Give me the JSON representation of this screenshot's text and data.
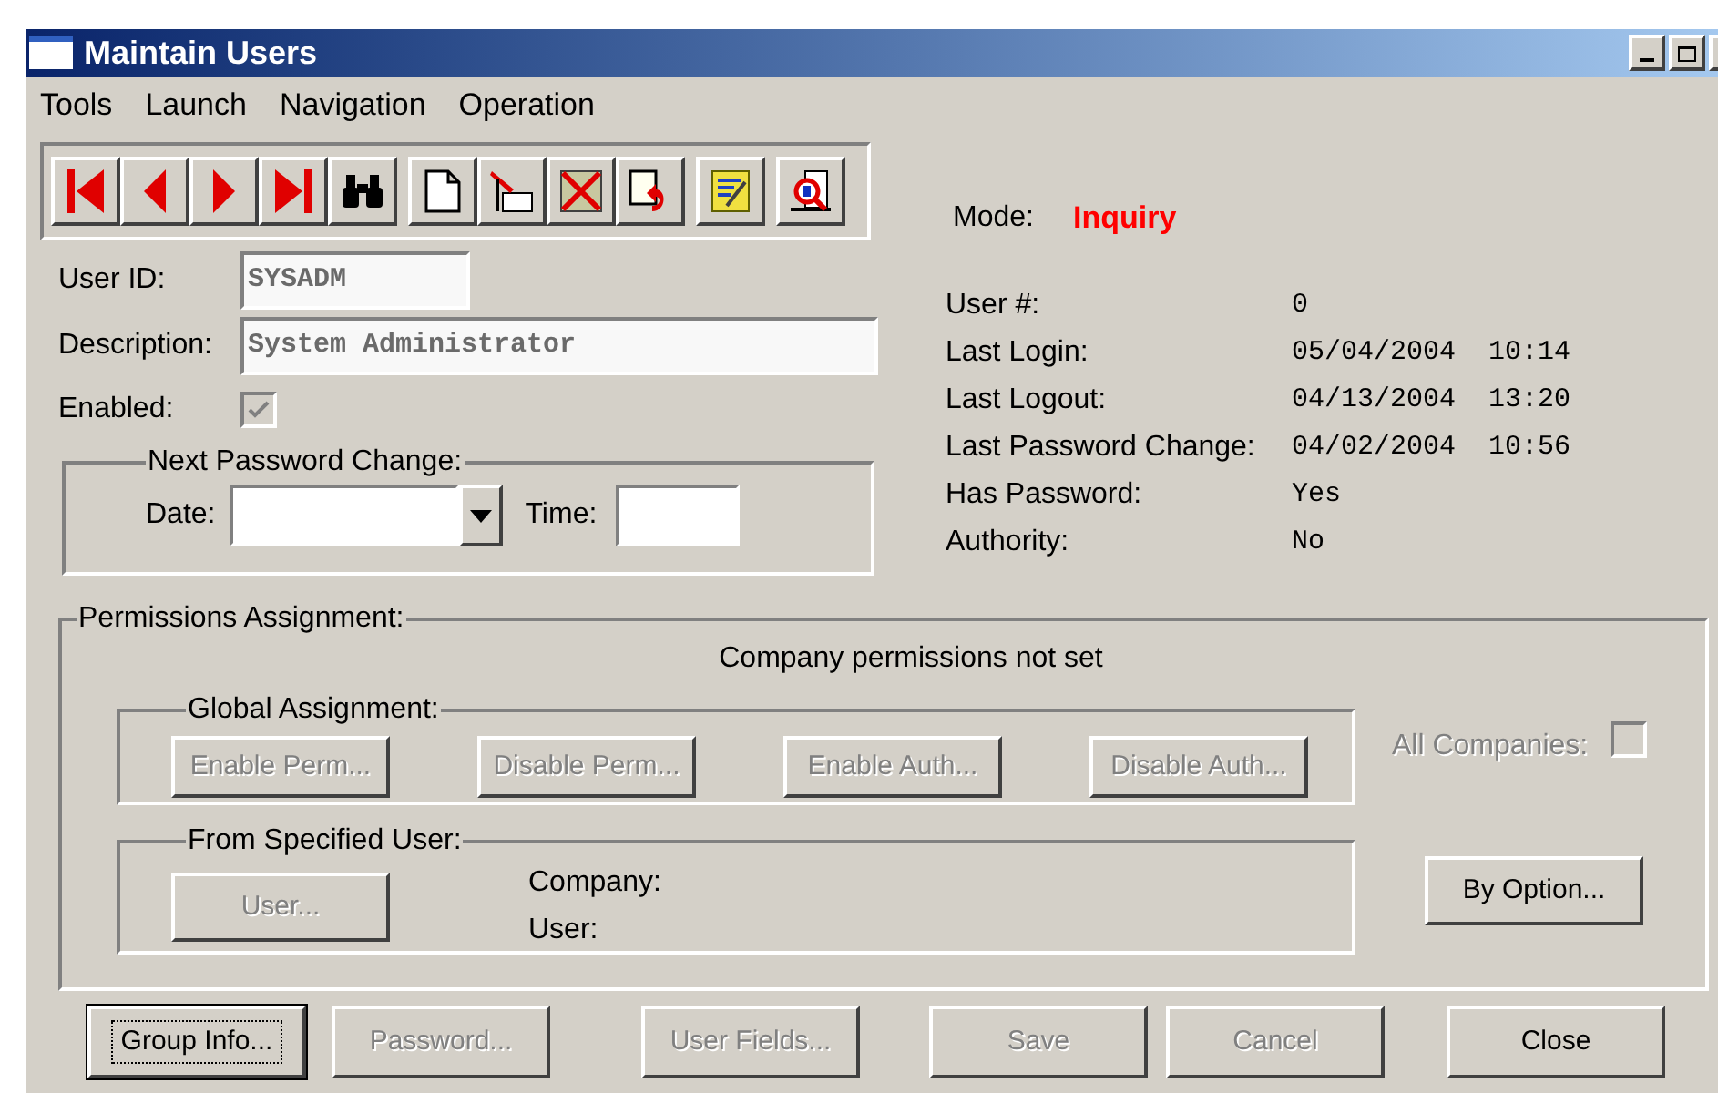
{
  "window": {
    "title": "Maintain Users"
  },
  "menu": [
    {
      "label": "Tools"
    },
    {
      "label": "Launch"
    },
    {
      "label": "Navigation"
    },
    {
      "label": "Operation"
    }
  ],
  "user_id": {
    "label": "User ID:",
    "value": "SYSADM",
    "disabled": true
  },
  "description": {
    "label": "Description:",
    "value": "System Administrator",
    "disabled": true
  },
  "enabled": {
    "label": "Enabled:",
    "checked": true,
    "disabled": true
  },
  "next_password_change": {
    "title": "Next Password Change:",
    "date_label": "Date:",
    "time_label": "Time:"
  },
  "mode": {
    "label": "Mode:",
    "value": "Inquiry"
  },
  "info": [
    {
      "label": "User #:",
      "value": "0"
    },
    {
      "label": "Last Login:",
      "value": "05/04/2004  10:14"
    },
    {
      "label": "Last Logout:",
      "value": "04/13/2004  13:20"
    },
    {
      "label": "Last Password Change:",
      "value": "04/02/2004  10:56"
    },
    {
      "label": "Has Password:",
      "value": "Yes"
    },
    {
      "label": "Authority:",
      "value": "No"
    }
  ],
  "permissions": {
    "title": "Permissions Assignment:",
    "message": "Company permissions not set",
    "global_assignment": {
      "title": "Global Assignment:",
      "buttons": [
        {
          "label": "Enable Perm...",
          "disabled": true
        },
        {
          "label": "Disable Perm...",
          "disabled": true
        },
        {
          "label": "Enable Auth...",
          "disabled": true
        },
        {
          "label": "Disable Auth...",
          "disabled": true
        }
      ]
    },
    "all_companies": {
      "label": "All Companies:",
      "checked": false,
      "disabled": true
    },
    "from_specified_user": {
      "title": "From Specified User:",
      "user_button": {
        "label": "User...",
        "disabled": true
      },
      "company_label": "Company:",
      "user_label": "User:"
    },
    "by_option": {
      "label": "By Option...",
      "disabled": false
    }
  },
  "buttons": [
    {
      "label": "Group Info...",
      "disabled": false,
      "focused": true
    },
    {
      "label": "Password...",
      "disabled": true,
      "focused": false
    },
    {
      "label": "User Fields...",
      "disabled": true,
      "focused": false
    },
    {
      "label": "Save",
      "disabled": true,
      "focused": false
    },
    {
      "label": "Cancel",
      "disabled": true,
      "focused": false
    },
    {
      "label": "Close",
      "disabled": false,
      "focused": false
    }
  ]
}
